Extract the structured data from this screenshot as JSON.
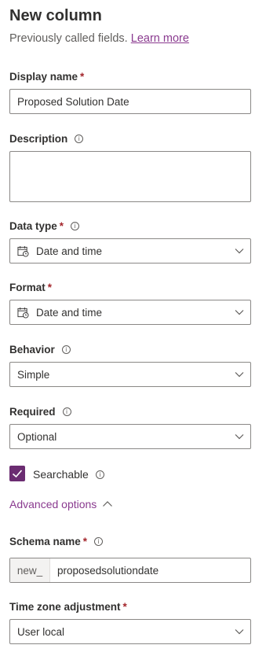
{
  "header": {
    "title": "New column",
    "subtitle": "Previously called fields.",
    "learn_more": "Learn more"
  },
  "display_name": {
    "label": "Display name",
    "required": "*",
    "value": "Proposed Solution Date"
  },
  "description": {
    "label": "Description",
    "value": ""
  },
  "data_type": {
    "label": "Data type",
    "required": "*",
    "value": "Date and time",
    "icon": "calendar-clock-icon"
  },
  "format": {
    "label": "Format",
    "required": "*",
    "value": "Date and time",
    "icon": "calendar-clock-icon"
  },
  "behavior": {
    "label": "Behavior",
    "value": "Simple"
  },
  "required_field": {
    "label": "Required",
    "value": "Optional"
  },
  "searchable": {
    "label": "Searchable",
    "checked": true
  },
  "advanced": {
    "label": "Advanced options",
    "expanded": true
  },
  "schema_name": {
    "label": "Schema name",
    "required": "*",
    "prefix": "new_",
    "value": "proposedsolutiondate"
  },
  "timezone": {
    "label": "Time zone adjustment",
    "required": "*",
    "value": "User local"
  },
  "colors": {
    "accent": "#8a3a8f",
    "checkbox": "#6b2c71",
    "required": "#a4262c",
    "border": "#8a8886"
  }
}
